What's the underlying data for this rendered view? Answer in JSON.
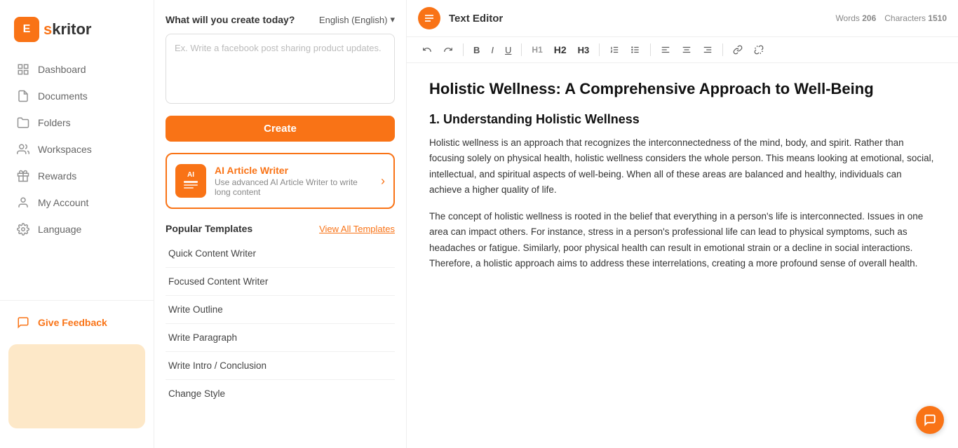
{
  "logo": {
    "icon": "E",
    "text_before": "s",
    "text_after": "kritor",
    "full": "Eskritor"
  },
  "sidebar": {
    "items": [
      {
        "id": "dashboard",
        "label": "Dashboard",
        "icon": "grid"
      },
      {
        "id": "documents",
        "label": "Documents",
        "icon": "file"
      },
      {
        "id": "folders",
        "label": "Folders",
        "icon": "folder"
      },
      {
        "id": "workspaces",
        "label": "Workspaces",
        "icon": "users"
      },
      {
        "id": "rewards",
        "label": "Rewards",
        "icon": "gift"
      },
      {
        "id": "my-account",
        "label": "My Account",
        "icon": "user"
      },
      {
        "id": "language",
        "label": "Language",
        "icon": "settings"
      }
    ],
    "bottom_items": [
      {
        "id": "give-feedback",
        "label": "Give Feedback",
        "icon": "feedback"
      }
    ]
  },
  "middle": {
    "create_label": "What will you create today?",
    "language_label": "English (English)",
    "textarea_placeholder": "Ex. Write a facebook post sharing product updates.",
    "create_button": "Create",
    "ai_writer": {
      "title": "AI Article Writer",
      "description": "Use advanced AI Article Writer to write long content",
      "icon_label": "AI"
    },
    "popular_templates_title": "Popular Templates",
    "view_all_label": "View All Templates",
    "templates": [
      {
        "label": "Quick Content Writer"
      },
      {
        "label": "Focused Content Writer"
      },
      {
        "label": "Write Outline"
      },
      {
        "label": "Write Paragraph"
      },
      {
        "label": "Write Intro / Conclusion"
      },
      {
        "label": "Change Style"
      }
    ]
  },
  "editor": {
    "title": "Text Editor",
    "words_label": "Words",
    "words_count": "206",
    "characters_label": "Characters",
    "characters_count": "1510",
    "toolbar": {
      "undo": "↺",
      "redo": "↻",
      "bold": "B",
      "italic": "I",
      "underline": "U",
      "h1": "H1",
      "h2": "H2",
      "h3": "H3",
      "ordered_list": "ol",
      "unordered_list": "ul",
      "align_left": "≡",
      "align_center": "≡",
      "align_right": "≡",
      "link": "🔗",
      "unlink": "⊘"
    },
    "doc_title": "Holistic Wellness: A Comprehensive Approach to Well-Being",
    "section1_heading": "1. Understanding Holistic Wellness",
    "paragraph1": "Holistic wellness is an approach that recognizes the interconnectedness of the mind, body, and spirit. Rather than focusing solely on physical health, holistic wellness considers the whole person. This means looking at emotional, social, intellectual, and spiritual aspects of well-being. When all of these areas are balanced and healthy, individuals can achieve a higher quality of life.",
    "paragraph2": "The concept of holistic wellness is rooted in the belief that everything in a person's life is interconnected. Issues in one area can impact others. For instance, stress in a person's professional life can lead to physical symptoms, such as headaches or fatigue. Similarly, poor physical health can result in emotional strain or a decline in social interactions. Therefore, a holistic approach aims to address these interrelations, creating a more profound sense of overall health."
  }
}
